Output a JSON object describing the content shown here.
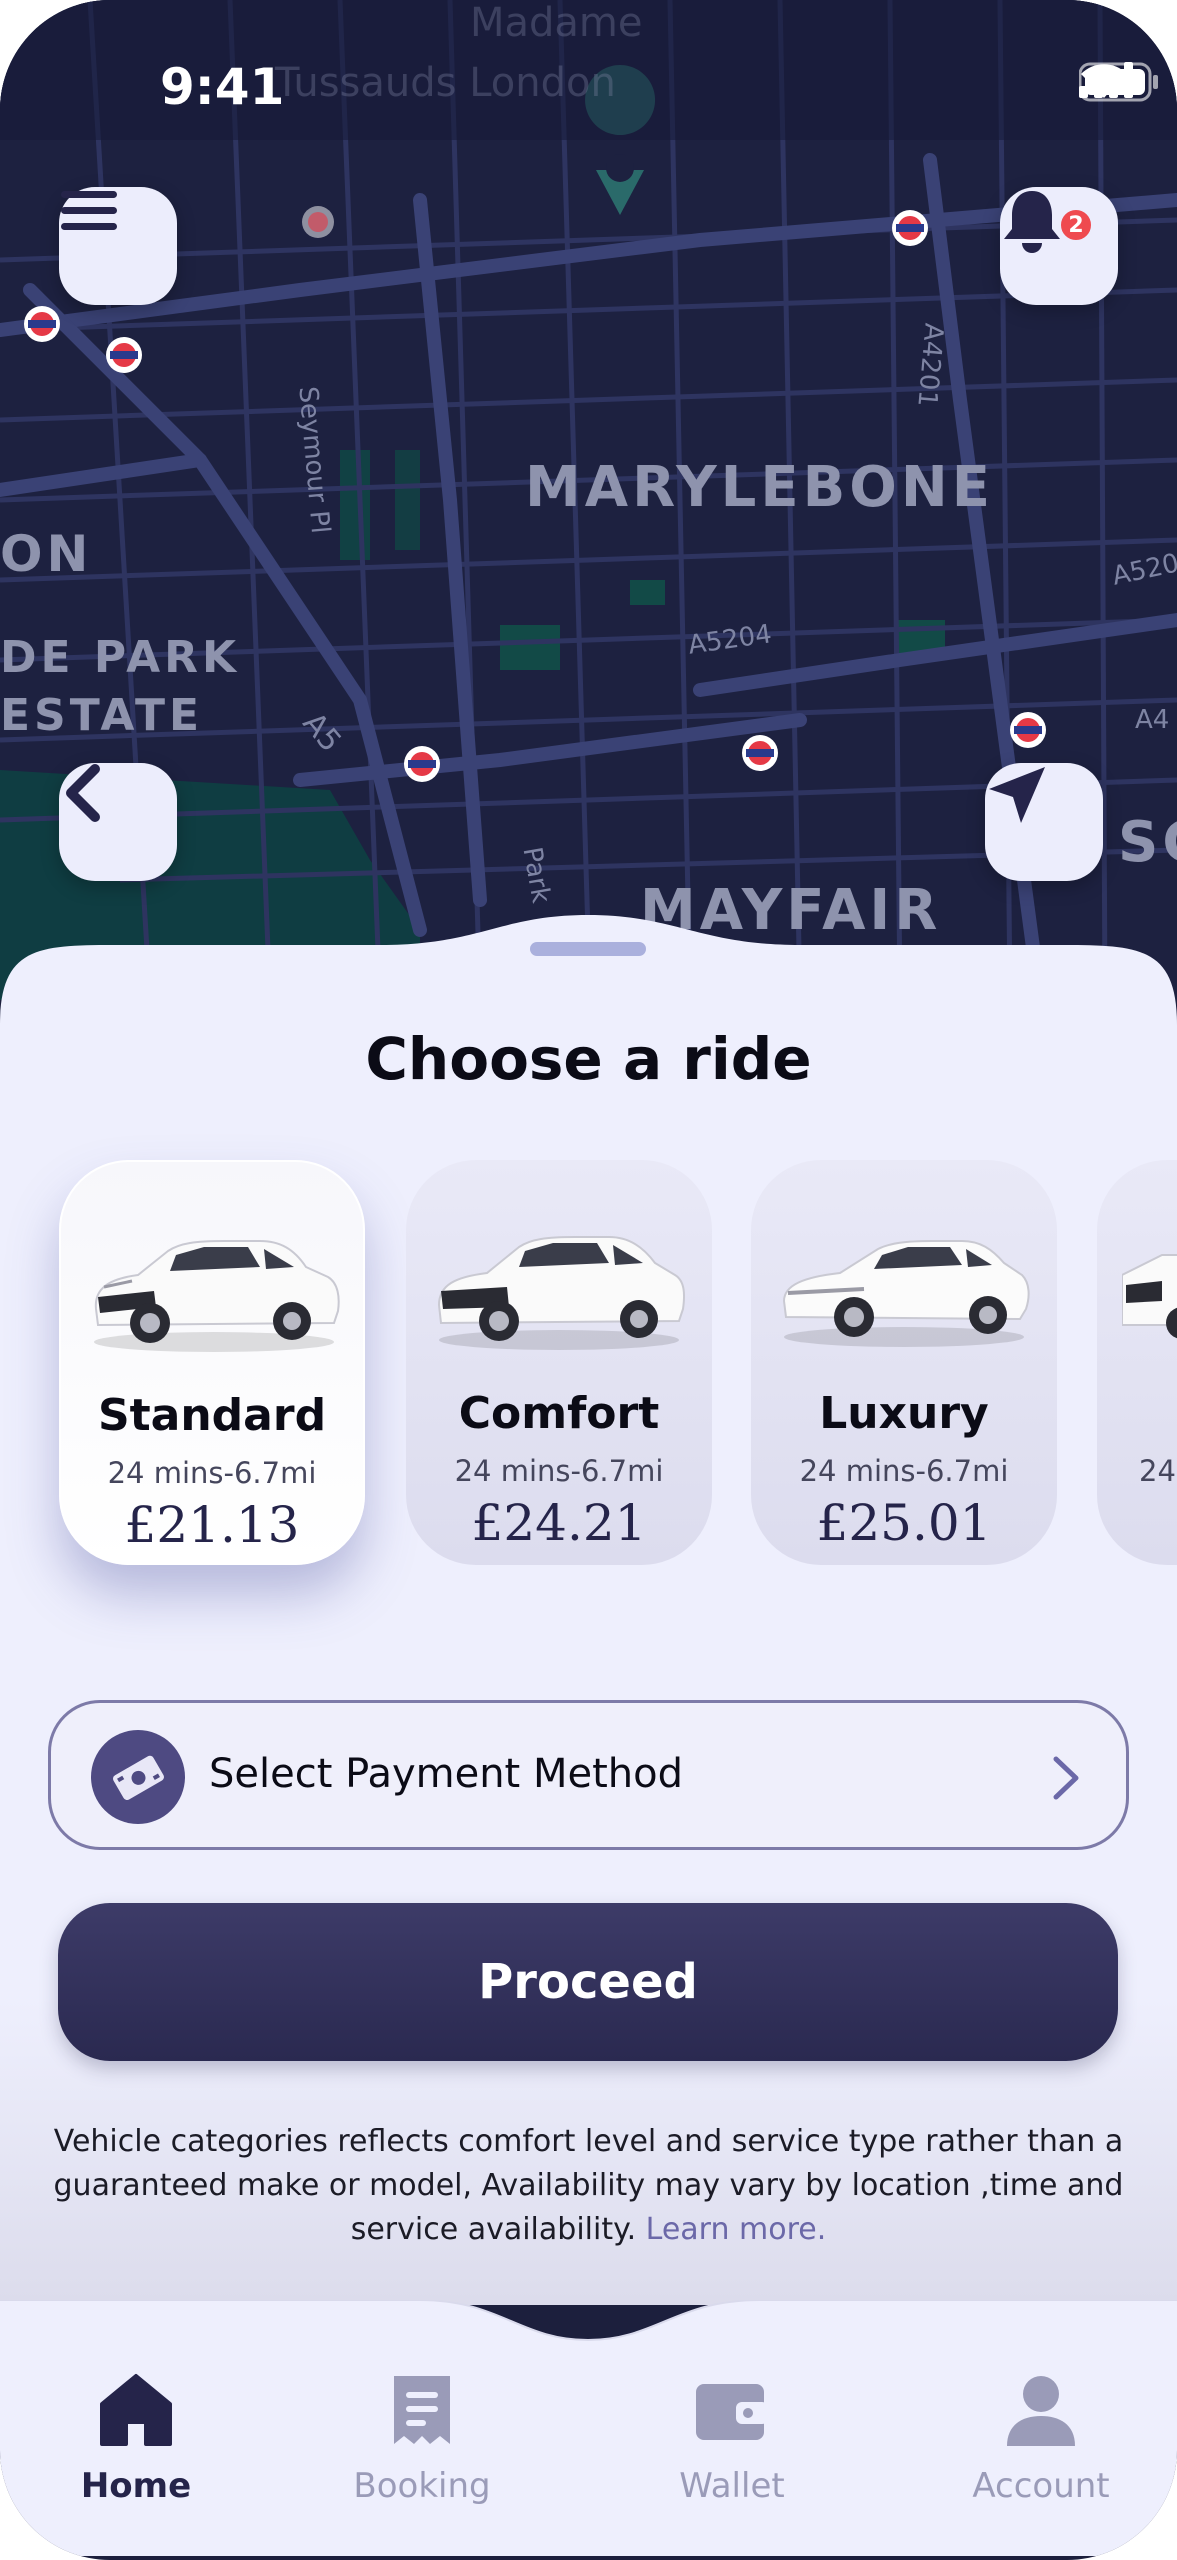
{
  "status_bar": {
    "time": "9:41",
    "icons": [
      "signal-icon",
      "wifi-icon",
      "battery-icon"
    ]
  },
  "map": {
    "labels": [
      "MARYLEBONE",
      "MAYFAIR",
      "ON",
      "DE PARK",
      "ESTATE",
      "SC"
    ],
    "road_labels": [
      "A5204",
      "Seymour Pl",
      "A4201",
      "A5",
      "Park",
      "A520",
      "A4",
      "Madame",
      "Tussauds London"
    ],
    "buttons": {
      "menu": "menu-icon",
      "notifications": "bell-icon",
      "back": "chevron-left-icon",
      "locate": "navigation-arrow-icon"
    },
    "notification_count": "2"
  },
  "sheet": {
    "title": "Choose a ride",
    "rides": [
      {
        "name": "Standard",
        "meta": "24 mins-6.7mi",
        "price": "£21.13",
        "selected": true
      },
      {
        "name": "Comfort",
        "meta": "24 mins-6.7mi",
        "price": "£24.21",
        "selected": false
      },
      {
        "name": "Luxury",
        "meta": "24 mins-6.7mi",
        "price": "£25.01",
        "selected": false
      },
      {
        "name": "",
        "meta": "24",
        "price": "",
        "selected": false
      }
    ],
    "payment": {
      "label": "Select Payment Method",
      "icon": "cash-icon"
    },
    "proceed_label": "Proceed",
    "disclaimer": "Vehicle categories reflects comfort level and service type rather than a guaranteed make or model, Availability may vary by location ,time and service availability.",
    "learn_more": "Learn more."
  },
  "nav": {
    "items": [
      {
        "label": "Home",
        "icon": "home-icon",
        "active": true
      },
      {
        "label": "Booking",
        "icon": "booking-icon",
        "active": false
      },
      {
        "label": "Wallet",
        "icon": "wallet-icon",
        "active": false
      },
      {
        "label": "Account",
        "icon": "account-icon",
        "active": false
      }
    ]
  },
  "colors": {
    "map_bg": "#1c1f3d",
    "sheet_bg": "#eeeffd",
    "primary": "#2f2d58",
    "accent": "#6b68a8",
    "badge": "#ef4a4f"
  }
}
